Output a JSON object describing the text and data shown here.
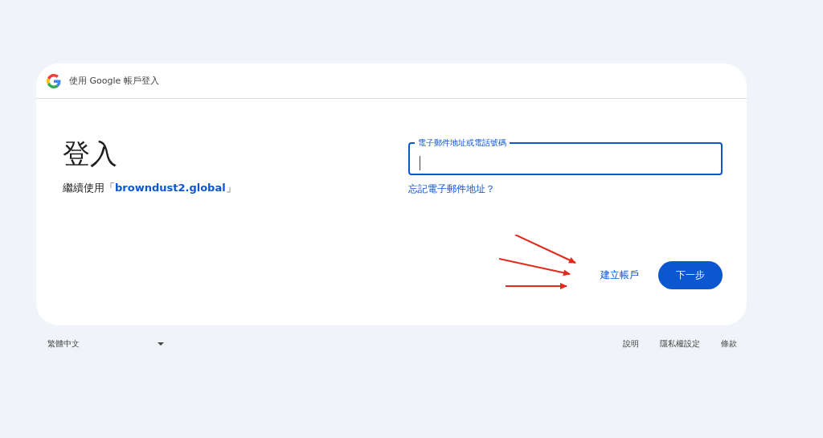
{
  "header": {
    "title": "使用 Google 帳戶登入"
  },
  "heading": "登入",
  "subtitle": {
    "prefix": "繼續使用「",
    "link": "browndust2.global",
    "suffix": "」"
  },
  "email_field": {
    "label": "電子郵件地址或電話號碼",
    "focused": true
  },
  "forgot_link": "忘記電子郵件地址？",
  "buttons": [
    {
      "kind": "text",
      "label": "建立帳戶"
    },
    {
      "kind": "filled",
      "label": "下一步"
    }
  ],
  "footer": {
    "language": "繁體中文",
    "links": [
      "說明",
      "隱私權設定",
      "條款"
    ]
  }
}
